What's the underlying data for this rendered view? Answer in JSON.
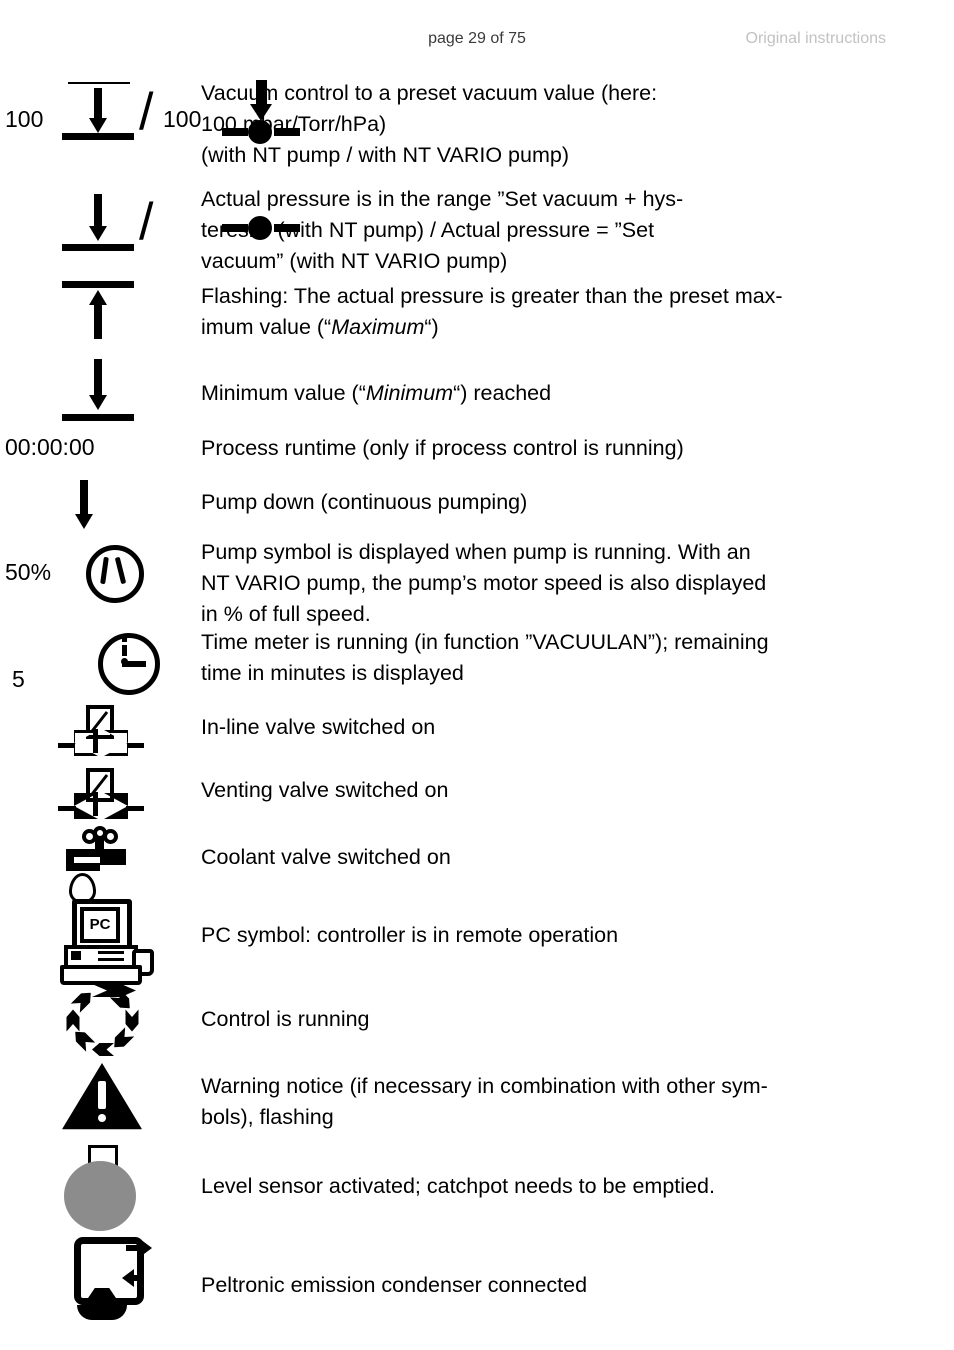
{
  "header": {
    "page_label": "page 29 of 75",
    "right_note": "Original instructions"
  },
  "legend": {
    "rows": [
      {
        "id": "vacuum-control-preset",
        "symbol_labels": {
          "left_value": "100",
          "right_value": "100",
          "separator": "/"
        },
        "text_lines": [
          "Vacuum control to a preset vacuum value (here:",
          "100 mbar/Torr/hPa)",
          "(with NT pump / with NT VARIO pump)"
        ]
      },
      {
        "id": "actual-pressure-in-range",
        "symbol_labels": {
          "separator": "/"
        },
        "text_lines": [
          "Actual pressure is in the range ”Set vacuum + hys-",
          "teresis” (with NT pump) / Actual pressure = ”Set",
          "vacuum” (with NT VARIO pump)"
        ]
      },
      {
        "id": "maximum-exceeded",
        "text_prefix": "Flashing: The actual pressure is greater than the preset max-imum value (“Maximum“)",
        "text_a": "Flashing: The actual pressure is greater than the preset max-",
        "text_b_pre": "imum value (“",
        "text_b_em": "Maximum",
        "text_b_post": "“)"
      },
      {
        "id": "minimum-reached",
        "text_pre": "Minimum value (“",
        "text_em": "Minimum",
        "text_post": "“) reached"
      },
      {
        "id": "process-runtime",
        "symbol_labels": {
          "value": "00:00:00"
        },
        "text": "Process runtime (only if process control is running)"
      },
      {
        "id": "pump-down",
        "text": "Pump down (continuous pumping)"
      },
      {
        "id": "pump-running",
        "symbol_labels": {
          "value": "50%"
        },
        "text_lines": [
          "Pump symbol is displayed when pump is running. With an",
          "NT VARIO pump, the pump’s motor speed is also displayed",
          "in % of full speed."
        ]
      },
      {
        "id": "time-meter",
        "symbol_labels": {
          "value": "5"
        },
        "text_lines": [
          "Time meter is running (in function ”VACUULAN”); remaining",
          "time in minutes is displayed"
        ]
      },
      {
        "id": "inline-valve",
        "text": "In-line valve switched on"
      },
      {
        "id": "venting-valve",
        "text": "Venting valve switched on"
      },
      {
        "id": "coolant-valve",
        "text": "Coolant valve switched on"
      },
      {
        "id": "pc-remote",
        "text": "PC symbol: controller is in remote operation"
      },
      {
        "id": "control-running",
        "text": "Control is running"
      },
      {
        "id": "warning-notice",
        "text_lines": [
          "Warning notice (if necessary in combination with other sym-",
          "bols), flashing"
        ]
      },
      {
        "id": "level-sensor",
        "text": "Level sensor activated; catchpot needs to be emptied."
      },
      {
        "id": "peltronic",
        "text": "Peltronic emission condenser connected"
      }
    ]
  },
  "symbols": {
    "pc_screen_text": "PC",
    "colors": {
      "ink": "#000000",
      "page_background": "#ffffff",
      "header_page_text": "#3a3a3a",
      "header_note_text": "#c2c2c2",
      "level_sensor_fill": "#8c8c8c"
    }
  }
}
